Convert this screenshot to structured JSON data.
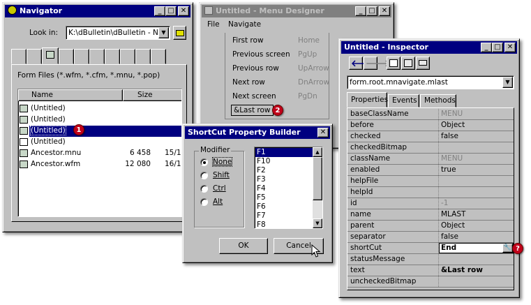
{
  "navigator": {
    "title": "Navigator",
    "look_in_label": "Look in:",
    "look_in_value": "K:\\dBulletin\\dBulletin - No",
    "file_filter": "Form Files (*.wfm, *.cfm, *.mnu, *.pop)",
    "col_name": "Name",
    "col_size": "Size",
    "files": [
      {
        "name": "(Untitled)",
        "size": "",
        "date": ""
      },
      {
        "name": "(Untitled)",
        "size": "",
        "date": ""
      },
      {
        "name": "(Untitled)",
        "size": "",
        "date": ""
      },
      {
        "name": "(Untitled)",
        "size": "",
        "date": ""
      },
      {
        "name": "Ancestor.mnu",
        "size": "6 458",
        "date": "15/1"
      },
      {
        "name": "Ancestor.wfm",
        "size": "12 080",
        "date": "16/1"
      }
    ],
    "badge": "1"
  },
  "menu_designer": {
    "title": "Untitled - Menu Designer",
    "menu_file": "File",
    "menu_navigate": "Navigate",
    "items": [
      {
        "label": "First row",
        "shortcut": "Home"
      },
      {
        "label": "Previous screen",
        "shortcut": "PgUp"
      },
      {
        "label": "Previous row",
        "shortcut": "UpArrow"
      },
      {
        "label": "Next row",
        "shortcut": "DnArrow"
      },
      {
        "label": "Next screen",
        "shortcut": "PgDn"
      },
      {
        "label": "&Last row",
        "shortcut": ""
      }
    ],
    "badge": "2"
  },
  "shortcut_builder": {
    "title": "ShortCut Property Builder",
    "group_label": "Modifier",
    "modifiers": [
      "None",
      "Shift",
      "Ctrl",
      "Alt"
    ],
    "selected_modifier": "None",
    "keys": [
      "F1",
      "F10",
      "F2",
      "F3",
      "F4",
      "F5",
      "F6",
      "F7",
      "F8"
    ],
    "selected_key": "F1",
    "ok": "OK",
    "cancel": "Cancel"
  },
  "inspector": {
    "title": "Untitled - Inspector",
    "object": "form.root.mnavigate.mlast",
    "tabs": [
      "Properties",
      "Events",
      "Methods"
    ],
    "properties": [
      {
        "name": "baseClassName",
        "value": "MENU",
        "dim": true
      },
      {
        "name": "before",
        "value": "Object"
      },
      {
        "name": "checked",
        "value": "false"
      },
      {
        "name": "checkedBitmap",
        "value": ""
      },
      {
        "name": "className",
        "value": "MENU",
        "dim": true
      },
      {
        "name": "enabled",
        "value": "true"
      },
      {
        "name": "helpFile",
        "value": ""
      },
      {
        "name": "helpId",
        "value": ""
      },
      {
        "name": "id",
        "value": "-1",
        "dim": true
      },
      {
        "name": "name",
        "value": "MLAST"
      },
      {
        "name": "parent",
        "value": "Object"
      },
      {
        "name": "separator",
        "value": "false"
      },
      {
        "name": "shortCut",
        "value": "End",
        "editing": true
      },
      {
        "name": "statusMessage",
        "value": ""
      },
      {
        "name": "text",
        "value": "&Last row",
        "bold": true
      },
      {
        "name": "uncheckedBitmap",
        "value": ""
      }
    ],
    "badge": "?"
  },
  "colors": {
    "titlebar_active": "#000080",
    "titlebar_inactive": "#808080",
    "face": "#c0c0c0",
    "badge": "#c0001a"
  }
}
